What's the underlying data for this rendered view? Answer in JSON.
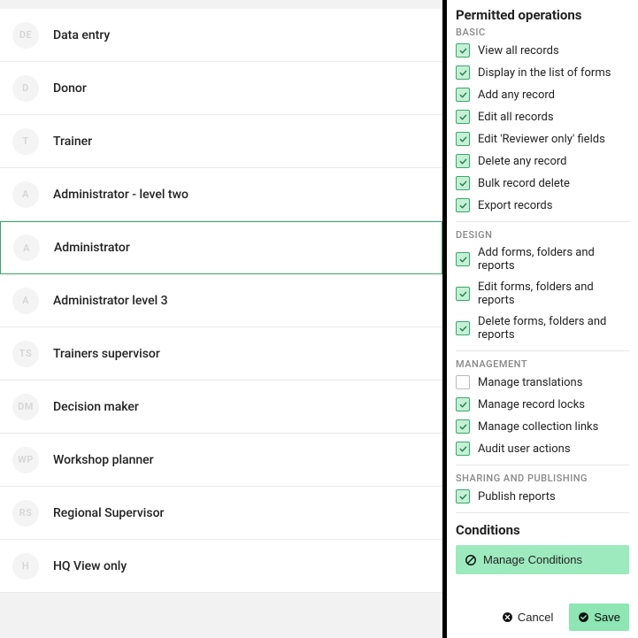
{
  "roles": [
    {
      "initials": "DE",
      "label": "Data entry",
      "selected": false
    },
    {
      "initials": "D",
      "label": "Donor",
      "selected": false
    },
    {
      "initials": "T",
      "label": "Trainer",
      "selected": false
    },
    {
      "initials": "A",
      "label": "Administrator - level two",
      "selected": false
    },
    {
      "initials": "A",
      "label": "Administrator",
      "selected": true
    },
    {
      "initials": "A",
      "label": "Administrator level 3",
      "selected": false
    },
    {
      "initials": "TS",
      "label": "Trainers supervisor",
      "selected": false
    },
    {
      "initials": "DM",
      "label": "Decision maker",
      "selected": false
    },
    {
      "initials": "WP",
      "label": "Workshop planner",
      "selected": false
    },
    {
      "initials": "RS",
      "label": "Regional Supervisor",
      "selected": false
    },
    {
      "initials": "H",
      "label": "HQ View only",
      "selected": false
    }
  ],
  "panel": {
    "title": "Permitted operations",
    "sections": {
      "basic": {
        "label": "BASIC",
        "items": [
          {
            "label": "View all records",
            "checked": true
          },
          {
            "label": "Display in the list of forms",
            "checked": true
          },
          {
            "label": "Add any record",
            "checked": true
          },
          {
            "label": "Edit all records",
            "checked": true
          },
          {
            "label": "Edit 'Reviewer only' fields",
            "checked": true
          },
          {
            "label": "Delete any record",
            "checked": true
          },
          {
            "label": "Bulk record delete",
            "checked": true
          },
          {
            "label": "Export records",
            "checked": true
          }
        ]
      },
      "design": {
        "label": "DESIGN",
        "items": [
          {
            "label": "Add forms, folders and reports",
            "checked": true
          },
          {
            "label": "Edit forms, folders and reports",
            "checked": true
          },
          {
            "label": "Delete forms, folders and reports",
            "checked": true
          }
        ]
      },
      "management": {
        "label": "MANAGEMENT",
        "items": [
          {
            "label": "Manage translations",
            "checked": false
          },
          {
            "label": "Manage record locks",
            "checked": true
          },
          {
            "label": "Manage collection links",
            "checked": true
          },
          {
            "label": "Audit user actions",
            "checked": true
          }
        ]
      },
      "sharing": {
        "label": "SHARING AND PUBLISHING",
        "items": [
          {
            "label": "Publish reports",
            "checked": true
          }
        ]
      }
    },
    "conditions": {
      "title": "Conditions",
      "manage_label": "Manage Conditions"
    },
    "actions": {
      "cancel": "Cancel",
      "save": "Save"
    }
  }
}
